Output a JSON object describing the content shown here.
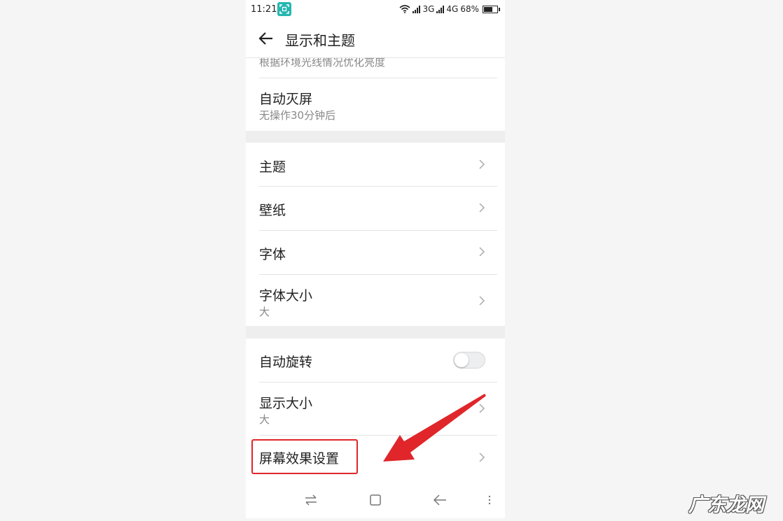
{
  "status_bar": {
    "time": "11:21",
    "net1": "3G",
    "net2": "4G",
    "battery": "68%"
  },
  "header": {
    "title": "显示和主题",
    "back_icon": "arrow-left-icon"
  },
  "card1": {
    "partial_sub": "根据环境光线情况优化亮度",
    "auto_screen_off": {
      "label": "自动灭屏",
      "sub": "无操作30分钟后"
    }
  },
  "card2": {
    "items": [
      {
        "label": "主题"
      },
      {
        "label": "壁纸"
      },
      {
        "label": "字体"
      },
      {
        "label": "字体大小",
        "sub": "大"
      }
    ]
  },
  "card3": {
    "auto_rotate": {
      "label": "自动旋转",
      "state": "off"
    },
    "display_size": {
      "label": "显示大小",
      "sub": "大"
    },
    "screen_effect": {
      "label": "屏幕效果设置"
    }
  },
  "annotation": {
    "arrow_color": "#e0262a",
    "box_color": "#e0262a"
  },
  "nav_bar": {
    "icons": [
      "switch-icon",
      "home-square-icon",
      "back-icon",
      "menu-dots-icon"
    ]
  },
  "watermark": "广东龙网"
}
